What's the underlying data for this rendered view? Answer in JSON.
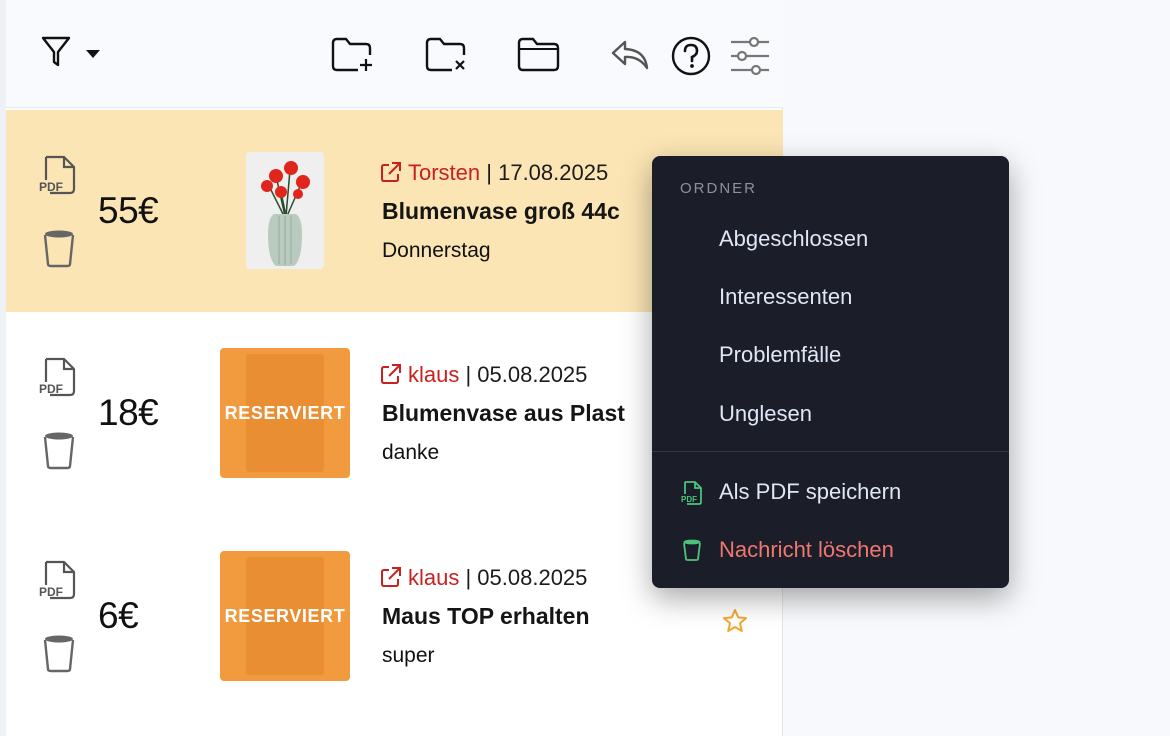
{
  "toolbar": {
    "icons": [
      "filter-icon",
      "chevron-down-icon",
      "folder-add-icon",
      "folder-remove-icon",
      "folder-icon",
      "reply-icon",
      "help-icon",
      "settings-sliders-icon"
    ]
  },
  "messages": [
    {
      "price": "55€",
      "user": "Torsten",
      "sep_date": " | 17.08.2025",
      "title": "Blumenvase groß 44c",
      "snippet": "Donnerstag",
      "selected": true,
      "thumb": "red-flowers-vase"
    },
    {
      "price": "18€",
      "user": "klaus",
      "sep_date": " | 05.08.2025",
      "title": "Blumenvase aus Plast",
      "snippet": "danke",
      "selected": false,
      "badge": "RESERVIERT"
    },
    {
      "price": "6€",
      "user": "klaus",
      "sep_date": " | 05.08.2025",
      "title": "Maus TOP erhalten",
      "snippet": "super",
      "selected": false,
      "badge": "RESERVIERT",
      "starred": false
    }
  ],
  "doc_icon_text": "PDF",
  "menu": {
    "header": "ORDNER",
    "folders": [
      "Abgeschlossen",
      "Interessenten",
      "Problemfälle",
      "Unglesen"
    ],
    "save_pdf": "Als PDF speichern",
    "pdf_icon_text": "PDF",
    "delete": "Nachricht löschen"
  },
  "colors": {
    "selected_row": "#fbe5b4",
    "user_link": "#c9211e",
    "reserved_badge": "#f19a3e",
    "menu_bg": "#1b1e29",
    "menu_green_icon": "#4cc37a",
    "menu_danger": "#f07670",
    "star": "#f0a92e"
  }
}
